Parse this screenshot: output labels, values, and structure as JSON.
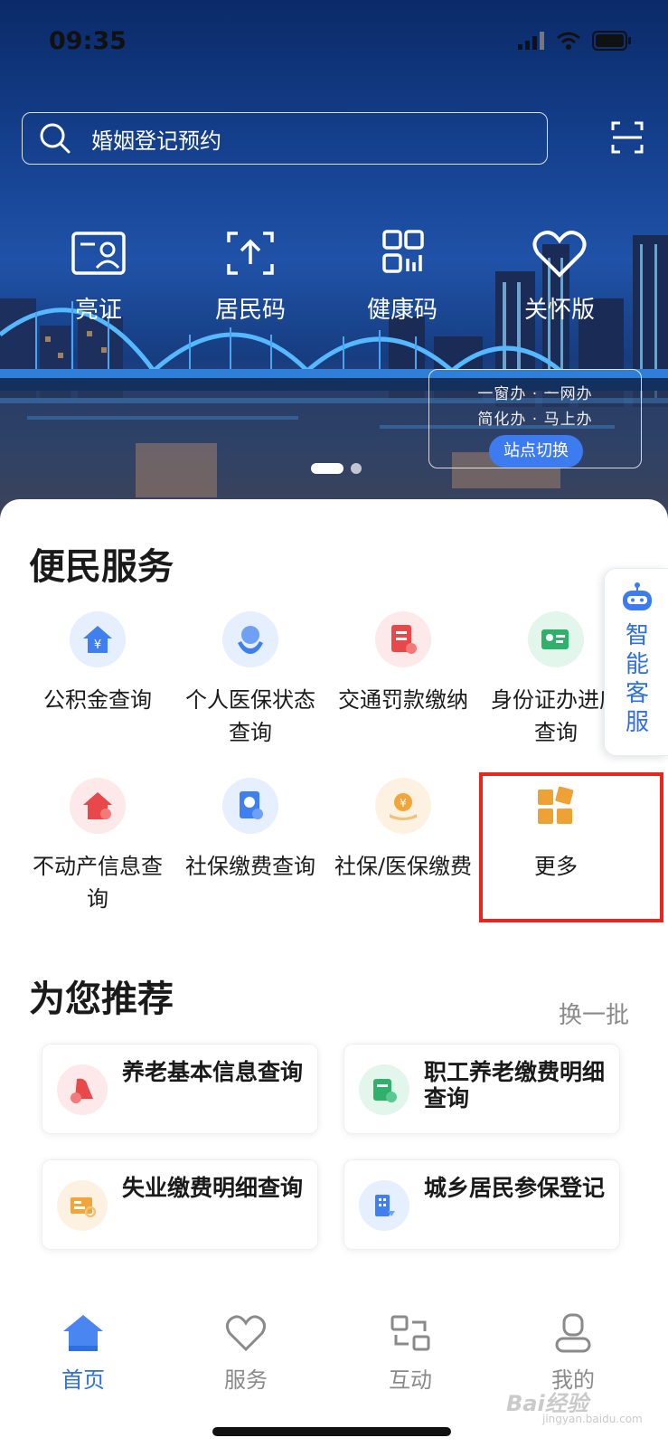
{
  "status_bar": {
    "time": "09:35"
  },
  "search": {
    "placeholder_text": "婚姻登记预约"
  },
  "quick_actions": [
    {
      "label": "亮证",
      "icon": "id-card-icon"
    },
    {
      "label": "居民码",
      "icon": "upload-code-icon"
    },
    {
      "label": "健康码",
      "icon": "qr-code-icon"
    },
    {
      "label": "关怀版",
      "icon": "heart-icon"
    }
  ],
  "station": {
    "line1": "一窗办 · 一网办",
    "line2": "简化办 · 马上办",
    "switch_label": "站点切换"
  },
  "convenience": {
    "title": "便民服务",
    "items": [
      {
        "label": "公积金查询",
        "icon": "housing-fund-icon",
        "color": "#3f7ff0"
      },
      {
        "label": "个人医保状态查询",
        "icon": "medical-insurance-icon",
        "color": "#3f7ff0"
      },
      {
        "label": "交通罚款缴纳",
        "icon": "traffic-fine-icon",
        "color": "#e8484a"
      },
      {
        "label": "身份证办进度查询",
        "icon": "id-card-progress-icon",
        "color": "#2fb06b"
      },
      {
        "label": "不动产信息查询",
        "icon": "real-estate-icon",
        "color": "#e8484a"
      },
      {
        "label": "社保缴费查询",
        "icon": "social-security-icon",
        "color": "#3f7ff0"
      },
      {
        "label": "社保/医保缴费",
        "icon": "payment-coin-icon",
        "color": "#f0a63a"
      },
      {
        "label": "更多",
        "icon": "more-grid-icon",
        "color": "#eea236"
      }
    ]
  },
  "smart_service": {
    "label": "智能客服",
    "icon": "robot-icon"
  },
  "recommend": {
    "title": "为您推荐",
    "refresh_label": "换一批",
    "items": [
      {
        "label": "养老基本信息查询",
        "icon": "pension-info-icon",
        "color": "#e8484a"
      },
      {
        "label": "职工养老缴费明细查询",
        "icon": "pension-payment-icon",
        "color": "#2fb06b"
      },
      {
        "label": "失业缴费明细查询",
        "icon": "unemployment-icon",
        "color": "#f0a63a"
      },
      {
        "label": "城乡居民参保登记",
        "icon": "insurance-register-icon",
        "color": "#3f7ff0"
      }
    ]
  },
  "tabs": [
    {
      "label": "首页",
      "icon": "home-icon",
      "active": true
    },
    {
      "label": "服务",
      "icon": "heart-outline-icon",
      "active": false
    },
    {
      "label": "互动",
      "icon": "interact-icon",
      "active": false
    },
    {
      "label": "我的",
      "icon": "profile-icon",
      "active": false
    }
  ],
  "watermark": {
    "text": "Bai经验",
    "sub": "jingyan.baidu.com"
  },
  "colors": {
    "accent": "#2f6fe0",
    "highlight": "#e8261f"
  }
}
